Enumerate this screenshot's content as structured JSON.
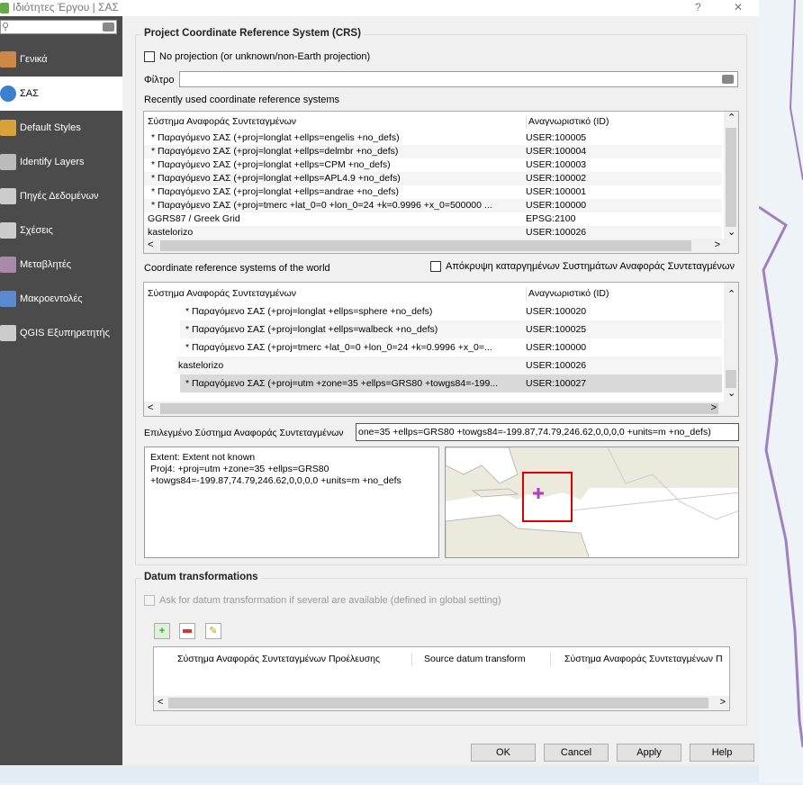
{
  "window": {
    "title": "Ιδιότητες Έργου | ΣΑΣ",
    "help": "?",
    "close": "✕"
  },
  "sidebar": {
    "items": [
      {
        "label": "Γενικά",
        "icon": "hammer-icon"
      },
      {
        "label": "ΣΑΣ",
        "icon": "globe-icon"
      },
      {
        "label": "Default Styles",
        "icon": "brush-icon"
      },
      {
        "label": "Identify Layers",
        "icon": "identify-icon"
      },
      {
        "label": "Πηγές Δεδομένων",
        "icon": "table-icon"
      },
      {
        "label": "Σχέσεις",
        "icon": "relations-icon"
      },
      {
        "label": "Μεταβλητές",
        "icon": "variable-icon"
      },
      {
        "label": "Μακροεντολές",
        "icon": "macro-icon"
      },
      {
        "label": "QGIS Εξυπηρετητής",
        "icon": "server-icon"
      }
    ]
  },
  "crs": {
    "group_title": "Project Coordinate Reference System (CRS)",
    "no_projection": "No projection (or unknown/non-Earth projection)",
    "filter_label": "Φίλτρο",
    "filter_value": "",
    "recent_label": "Recently used coordinate reference systems",
    "columns": [
      "Σύστημα Αναφοράς Συντεταγμένων",
      "Αναγνωριστικό (ID)"
    ],
    "recent": [
      [
        "* Παραγόμενο ΣΑΣ (+proj=longlat +ellps=engelis +no_defs)",
        "USER:100005"
      ],
      [
        "* Παραγόμενο ΣΑΣ (+proj=longlat +ellps=delmbr +no_defs)",
        "USER:100004"
      ],
      [
        "* Παραγόμενο ΣΑΣ (+proj=longlat +ellps=CPM +no_defs)",
        "USER:100003"
      ],
      [
        "* Παραγόμενο ΣΑΣ (+proj=longlat +ellps=APL4.9 +no_defs)",
        "USER:100002"
      ],
      [
        "* Παραγόμενο ΣΑΣ (+proj=longlat +ellps=andrae +no_defs)",
        "USER:100001"
      ],
      [
        "* Παραγόμενο ΣΑΣ (+proj=tmerc +lat_0=0 +lon_0=24 +k=0.9996 +x_0=500000 ...",
        "USER:100000"
      ],
      [
        "GGRS87 / Greek Grid",
        "EPSG:2100"
      ],
      [
        "kastelorizo",
        "USER:100026"
      ]
    ],
    "world_label": "Coordinate reference systems of the world",
    "hide_deprecated": "Απόκρυψη καταργημένων Συστημάτων Αναφοράς Συντεταγμένων",
    "world": [
      [
        "* Παραγόμενο ΣΑΣ (+proj=longlat +ellps=sphere +no_defs)",
        "USER:100020"
      ],
      [
        "* Παραγόμενο ΣΑΣ (+proj=longlat +ellps=walbeck +no_defs)",
        "USER:100025"
      ],
      [
        "* Παραγόμενο ΣΑΣ (+proj=tmerc +lat_0=0 +lon_0=24 +k=0.9996 +x_0=...",
        "USER:100000"
      ],
      [
        "kastelorizo",
        "USER:100026"
      ],
      [
        "* Παραγόμενο ΣΑΣ (+proj=utm +zone=35 +ellps=GRS80 +towgs84=-199...",
        "USER:100027"
      ]
    ],
    "selected_label": "Επιλεγμένο Σύστημα Αναφοράς Συντεταγμένων",
    "selected_value": "one=35 +ellps=GRS80 +towgs84=-199.87,74.79,246.62,0,0,0,0 +units=m +no_defs)",
    "extent": "Extent: Extent not known",
    "proj4_line1": "Proj4: +proj=utm +zone=35 +ellps=GRS80",
    "proj4_line2": "+towgs84=-199.87,74.79,246.62,0,0,0,0 +units=m +no_defs"
  },
  "datum": {
    "group_title": "Datum transformations",
    "ask": "Ask for datum transformation if several are available (defined in global setting)",
    "columns": [
      "Σύστημα Αναφοράς Συντεταγμένων Προέλευσης",
      "Source datum transform",
      "Σύστημα Αναφοράς Συντεταγμένων Π"
    ]
  },
  "buttons": {
    "ok": "OK",
    "cancel": "Cancel",
    "apply": "Apply",
    "help": "Help"
  },
  "colors": {
    "sidebar": "#4b4b4b",
    "extent_box": "#e00000",
    "marker": "#b040c0"
  }
}
